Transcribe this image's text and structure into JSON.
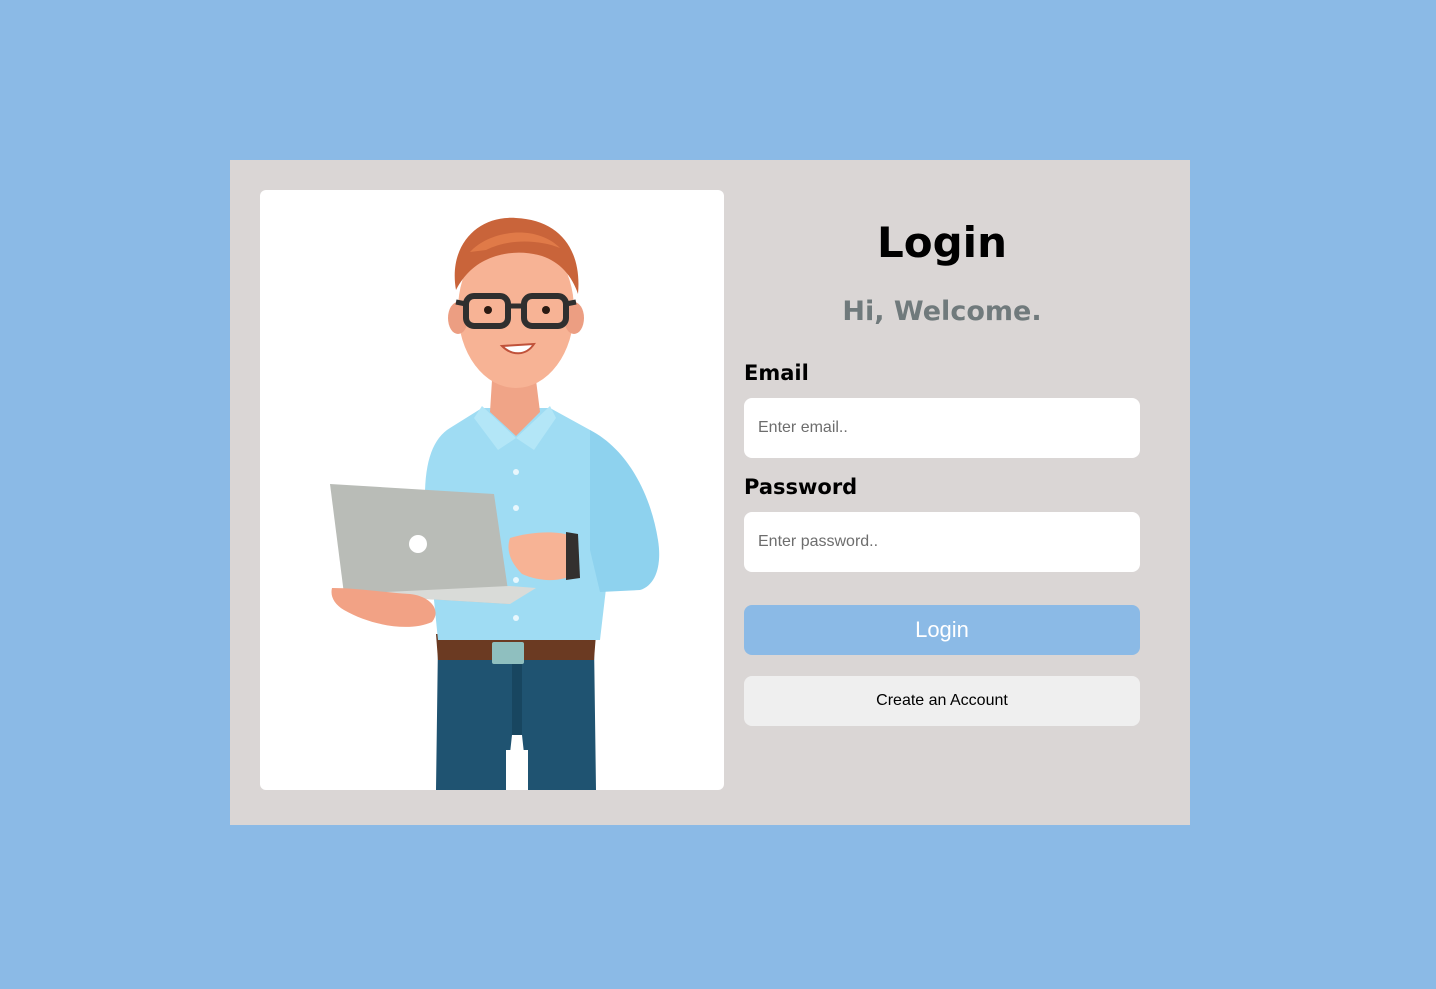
{
  "login_form": {
    "title": "Login",
    "subtitle": "Hi, Welcome.",
    "email": {
      "label": "Email",
      "placeholder": "Enter email..",
      "value": ""
    },
    "password": {
      "label": "Password",
      "placeholder": "Enter password..",
      "value": ""
    },
    "login_button_label": "Login",
    "create_account_label": "Create an Account"
  },
  "colors": {
    "page_background": "#8bbae6",
    "card_background": "#dad6d5",
    "login_button": "#8bbae6",
    "create_button": "#efefef",
    "subtitle_text": "#707a7c"
  }
}
